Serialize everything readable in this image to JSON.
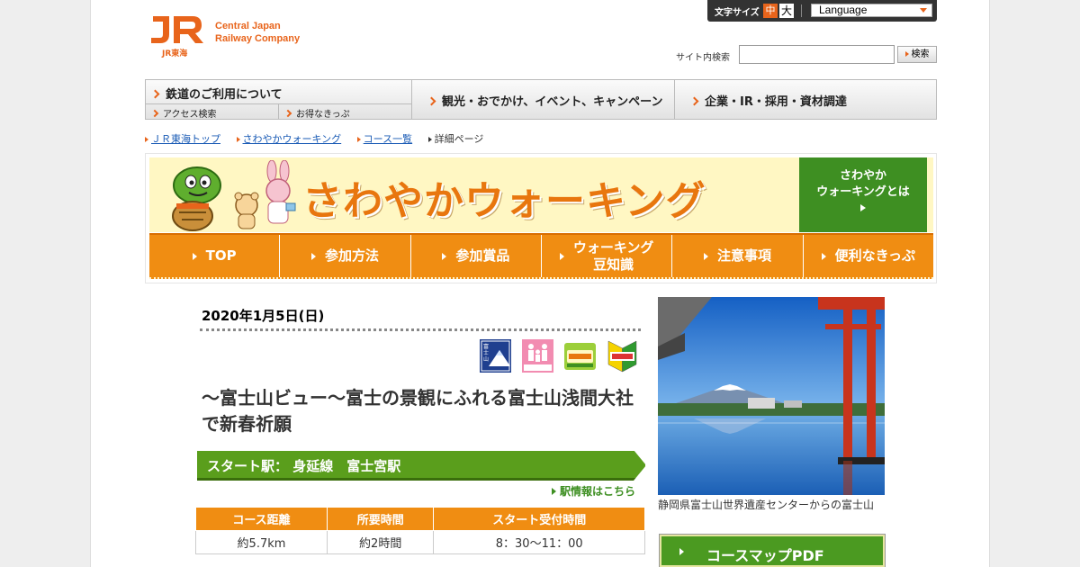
{
  "header": {
    "logo_mark": "JR",
    "logo_sub": "JR東海",
    "logo_line1": "Central Japan",
    "logo_line2": "Railway Company",
    "font_size_label": "文字サイズ",
    "font_size_mid": "中",
    "font_size_large": "大",
    "language_label": "Language",
    "search_label": "サイト内検索",
    "search_value": "",
    "search_button": "検索"
  },
  "global_nav": {
    "item1_main": "鉄道のご利用について",
    "item1_sub_a": "アクセス検索",
    "item1_sub_b": "お得なきっぷ",
    "item2": "観光・おでかけ、イベント、キャンペーン",
    "item3": "企業・IR・採用・資材調達"
  },
  "breadcrumb": {
    "home": "ＪＲ東海トップ",
    "walking": "さわやかウォーキング",
    "course_list": "コース一覧",
    "current": "詳細ページ"
  },
  "banner": {
    "title": "さわやかウォーキング",
    "about_line1": "さわやか",
    "about_line2": "ウォーキングとは",
    "nav": [
      {
        "line1": "TOP",
        "line2": ""
      },
      {
        "line1": "参加方法",
        "line2": ""
      },
      {
        "line1": "参加賞品",
        "line2": ""
      },
      {
        "line1": "ウォーキング",
        "line2": "豆知識"
      },
      {
        "line1": "注意事項",
        "line2": ""
      },
      {
        "line1": "便利なきっぷ",
        "line2": ""
      }
    ]
  },
  "article": {
    "date": "2020年1月5日(日)",
    "badges": [
      {
        "icon": "fuji-view-badge-icon",
        "text": "富士山ビュー"
      },
      {
        "icon": "family-badge-icon",
        "text": "ファミリー"
      },
      {
        "icon": "walking-badge-icon",
        "text": "さわやかウォーキング"
      },
      {
        "icon": "beginner-badge-icon",
        "text": "初心者向"
      }
    ],
    "title": "～富士山ビュー～富士の景観にふれる富士山浅間大社で新春祈願",
    "start_station": "スタート駅：  身延線　富士宮駅",
    "station_link": "駅情報はこちら",
    "table_headers": [
      "コース距離",
      "所要時間",
      "スタート受付時間"
    ],
    "table_values": [
      "約5.7km",
      "約2時間",
      "8：30～11：00"
    ]
  },
  "photo": {
    "caption": "静岡県富士山世界遺産センターからの富士山"
  },
  "pdf_button": "コースマップPDF",
  "colors": {
    "brand_orange": "#e8641b",
    "nav_orange": "#f08d12",
    "green": "#3e8f22",
    "banner_bg": "#fff7c3"
  }
}
